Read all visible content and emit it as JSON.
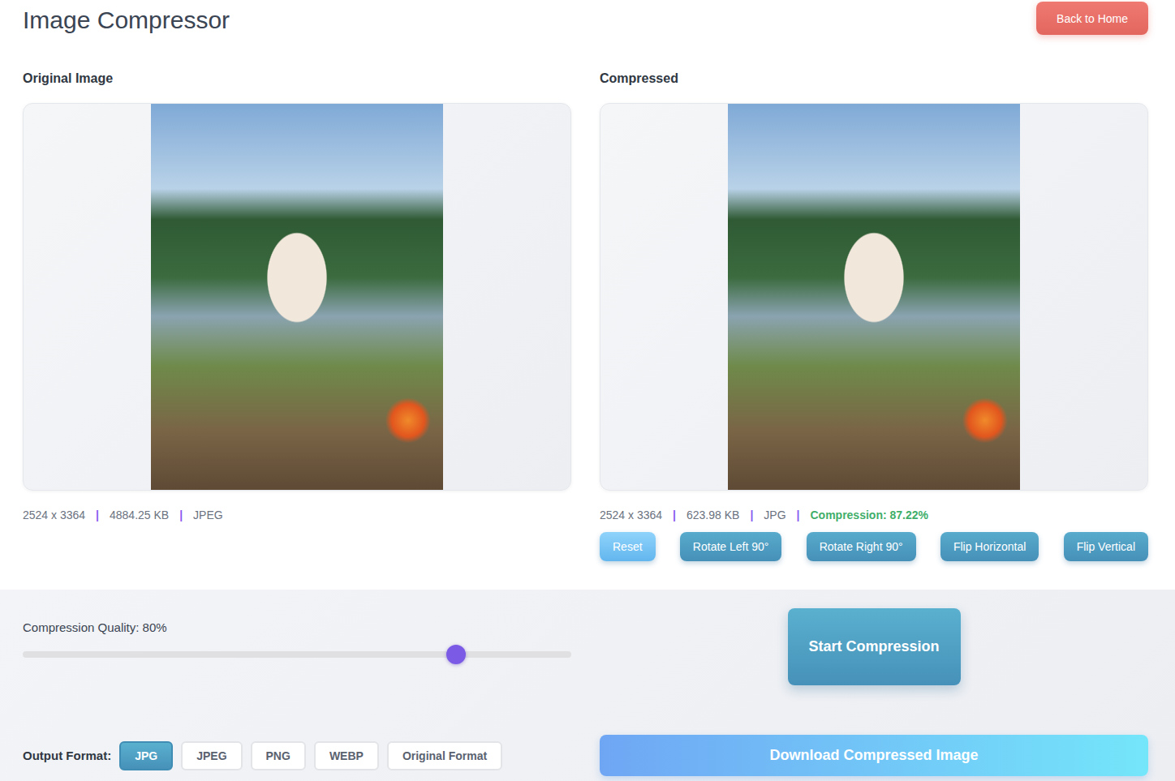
{
  "header": {
    "title": "Image Compressor",
    "back_button": "Back to Home"
  },
  "original": {
    "label": "Original Image",
    "dimensions": "2524 x 3364",
    "size": "4884.25 KB",
    "format": "JPEG"
  },
  "compressed": {
    "label": "Compressed",
    "dimensions": "2524 x 3364",
    "size": "623.98 KB",
    "format": "JPG",
    "compression": "Compression: 87.22%"
  },
  "separator": "|",
  "transform_buttons": [
    {
      "label": "Reset",
      "kind": "reset"
    },
    {
      "label": "Rotate Left 90°",
      "kind": "transform"
    },
    {
      "label": "Rotate Right 90°",
      "kind": "transform"
    },
    {
      "label": "Flip Horizontal",
      "kind": "transform"
    },
    {
      "label": "Flip Vertical",
      "kind": "transform"
    }
  ],
  "quality": {
    "label": "Compression Quality: 80%",
    "level": 0.8
  },
  "start_button": "Start Compression",
  "output_format": {
    "label": "Output Format:",
    "options": [
      {
        "label": "JPG",
        "selected": true
      },
      {
        "label": "JPEG",
        "selected": false
      },
      {
        "label": "PNG",
        "selected": false
      },
      {
        "label": "WEBP",
        "selected": false
      },
      {
        "label": "Original Format",
        "selected": false
      }
    ]
  },
  "download_button": "Download Compressed Image"
}
